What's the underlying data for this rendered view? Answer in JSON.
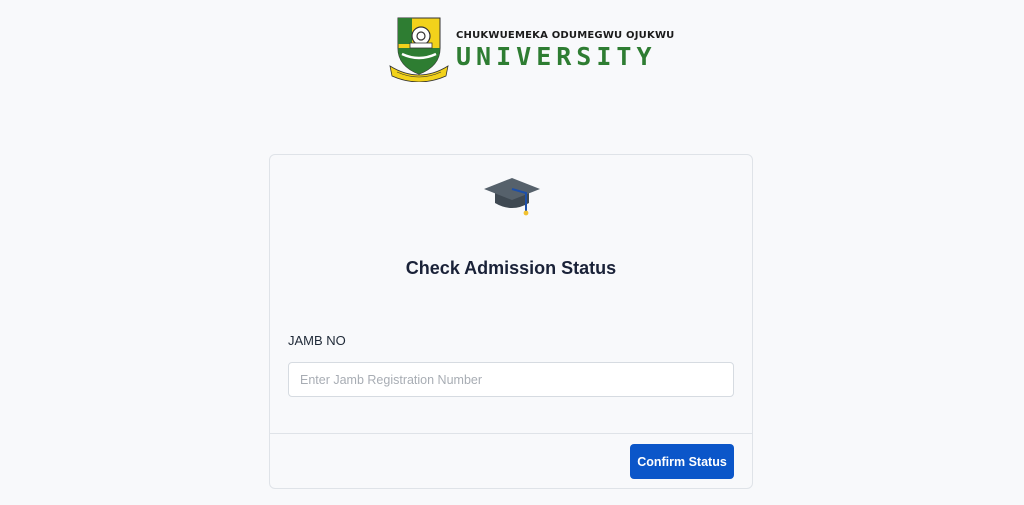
{
  "header": {
    "logo_icon": "university-crest-icon",
    "line1": "CHUKWUEMEKA ODUMEGWU OJUKWU",
    "line2": "UNIVERSITY",
    "brand_color": "#2e7d32"
  },
  "card": {
    "icon": "graduation-cap-icon",
    "title": "Check Admission Status",
    "field_label": "JAMB NO",
    "input_value": "",
    "input_placeholder": "Enter Jamb Registration Number",
    "button_label": "Confirm Status",
    "button_color": "#0b56c9"
  }
}
